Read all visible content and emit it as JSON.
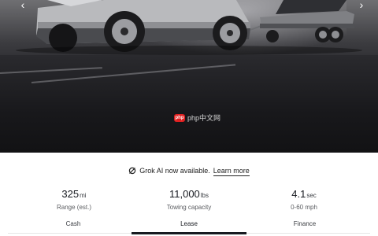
{
  "hero": {
    "prev_arrow": "‹",
    "next_arrow": "›",
    "watermark": "php中文网",
    "watermark_badge": "php"
  },
  "banner": {
    "text": "Grok AI now available.",
    "link": "Learn more"
  },
  "stats": [
    {
      "value": "325",
      "unit": "mi",
      "label": "Range (est.)"
    },
    {
      "value": "11,000",
      "unit": "lbs",
      "label": "Towing capacity"
    },
    {
      "value": "4.1",
      "unit": "sec",
      "label": "0-60 mph"
    }
  ],
  "tabs": [
    {
      "label": "Cash",
      "active": false
    },
    {
      "label": "Lease",
      "active": true
    },
    {
      "label": "Finance",
      "active": false
    }
  ]
}
